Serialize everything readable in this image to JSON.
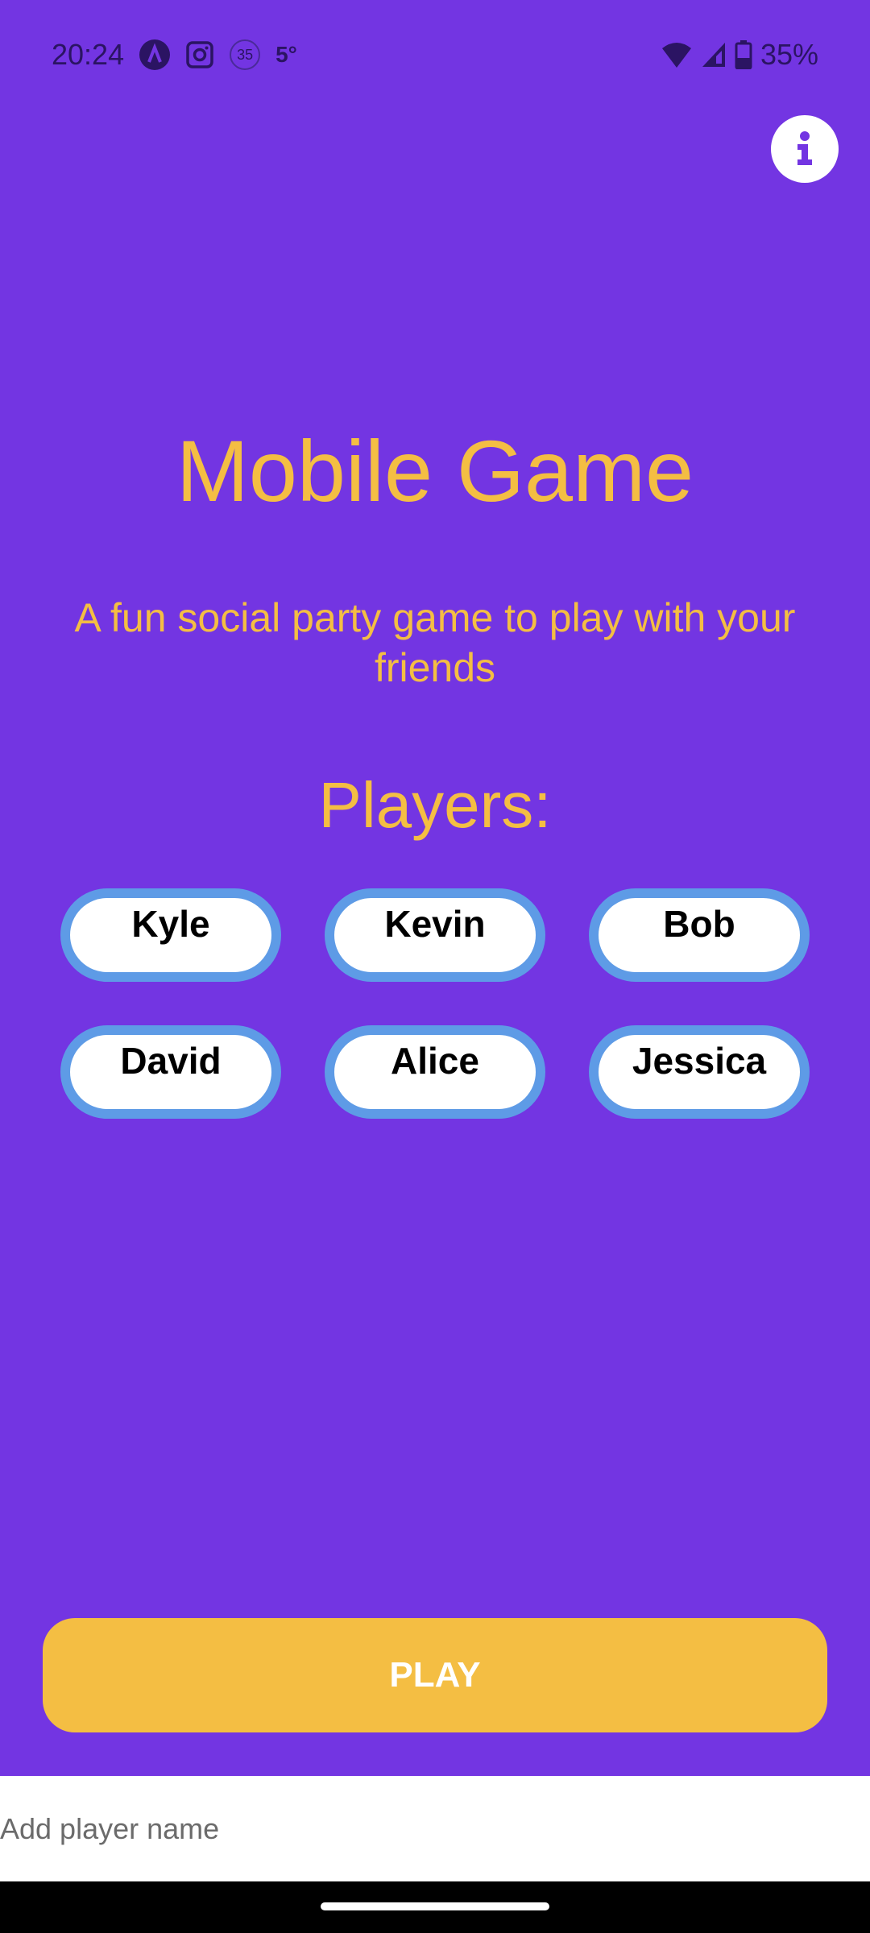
{
  "status_bar": {
    "time": "20:24",
    "notification_icons": [
      "app-a-icon",
      "instagram-icon",
      "aqi-35-icon",
      "weather-icon"
    ],
    "aqi_value": "35",
    "temperature": "5°",
    "battery_percent": "35%",
    "battery_level": 35
  },
  "header": {
    "info_icon": "info-icon"
  },
  "main": {
    "title": "Mobile Game",
    "subtitle": "A fun social party game to play with your friends",
    "players_heading": "Players:",
    "players": [
      "Kyle",
      "Kevin",
      "Bob",
      "David",
      "Alice",
      "Jessica"
    ]
  },
  "play_button": {
    "label": "PLAY"
  },
  "add_player": {
    "placeholder": "Add player name",
    "value": ""
  },
  "colors": {
    "background": "#7335E2",
    "accent": "#F4BE43",
    "chip_border": "#5E9BE6",
    "chip_fill": "#FFFFFF"
  }
}
